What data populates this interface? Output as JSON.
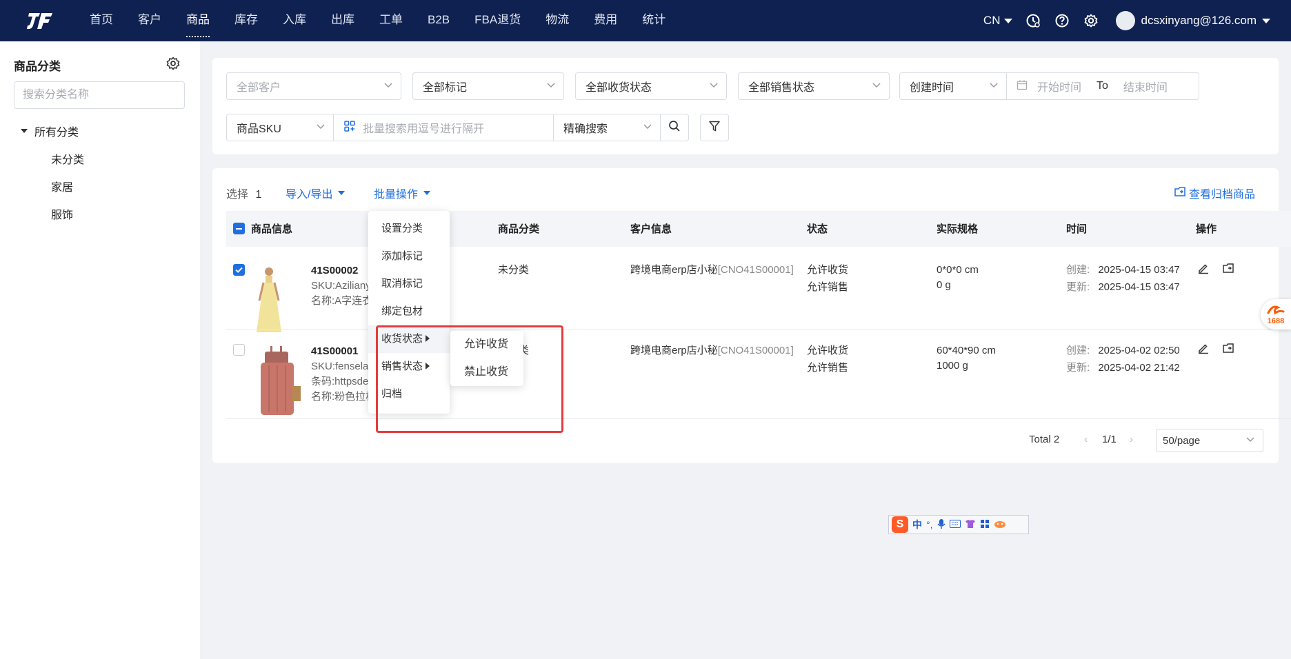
{
  "nav": {
    "items": [
      {
        "label": "首页"
      },
      {
        "label": "客户"
      },
      {
        "label": "商品",
        "active": true
      },
      {
        "label": "库存"
      },
      {
        "label": "入库"
      },
      {
        "label": "出库"
      },
      {
        "label": "工单"
      },
      {
        "label": "B2B"
      },
      {
        "label": "FBA退货"
      },
      {
        "label": "物流"
      },
      {
        "label": "费用"
      },
      {
        "label": "统计"
      }
    ],
    "lang": "CN",
    "user": "dcsxinyang@126.com"
  },
  "sidebar": {
    "title": "商品分类",
    "search_placeholder": "搜索分类名称",
    "root": "所有分类",
    "children": [
      "未分类",
      "家居",
      "服饰"
    ]
  },
  "filters": {
    "customer": "全部客户",
    "mark": "全部标记",
    "receive_status": "全部收货状态",
    "sale_status": "全部销售状态",
    "time_type": "创建时间",
    "start_placeholder": "开始时间",
    "to": "To",
    "end_placeholder": "结束时间",
    "search_field": "商品SKU",
    "batch_placeholder": "批量搜索用逗号进行隔开",
    "match_mode": "精确搜索"
  },
  "toolbar": {
    "selected_label": "选择",
    "selected_count": "1",
    "import_export": "导入/导出",
    "batch_ops": "批量操作",
    "view_archived": "查看归档商品"
  },
  "table": {
    "headers": {
      "info": "商品信息",
      "category": "商品分类",
      "customer": "客户信息",
      "status": "状态",
      "spec": "实际规格",
      "time": "时间",
      "ops": "操作"
    },
    "rows": [
      {
        "code": "41S00002",
        "sku": "SKU:Azilianyi",
        "name": "名称:A字连衣",
        "category": "未分类",
        "customer": "跨境电商erp店小秘",
        "customer_code": "[CNO41S00001]",
        "status1": "允许收货",
        "status2": "允许销售",
        "size": "0*0*0 cm",
        "weight": "0 g",
        "created_label": "创建:",
        "created": "2025-04-15 03:47",
        "updated_label": "更新:",
        "updated": "2025-04-15 03:47"
      },
      {
        "code": "41S00001",
        "sku": "SKU:fenselaga",
        "barcode": "条码:httpsde",
        "name": "名称:粉色拉杆",
        "category": "类",
        "customer": "跨境电商erp店小秘",
        "customer_code": "[CNO41S00001]",
        "status1": "允许收货",
        "status2": "允许销售",
        "size": "60*40*90 cm",
        "weight": "1000 g",
        "created_label": "创建:",
        "created": "2025-04-02 02:50",
        "updated_label": "更新:",
        "updated": "2025-04-02 21:42"
      }
    ]
  },
  "batch_menu": {
    "items": [
      "设置分类",
      "添加标记",
      "取消标记",
      "绑定包材",
      "收货状态",
      "销售状态",
      "归档"
    ]
  },
  "receive_submenu": {
    "items": [
      "允许收货",
      "禁止收货"
    ]
  },
  "pager": {
    "total": "Total 2",
    "page": "1/1",
    "size": "50/page"
  },
  "ime": {
    "label": "中"
  },
  "badge": {
    "text": "1688"
  },
  "colors": {
    "nav_bg": "#0f2150",
    "accent": "#1f6fe0",
    "highlight": "#e63b3b"
  }
}
